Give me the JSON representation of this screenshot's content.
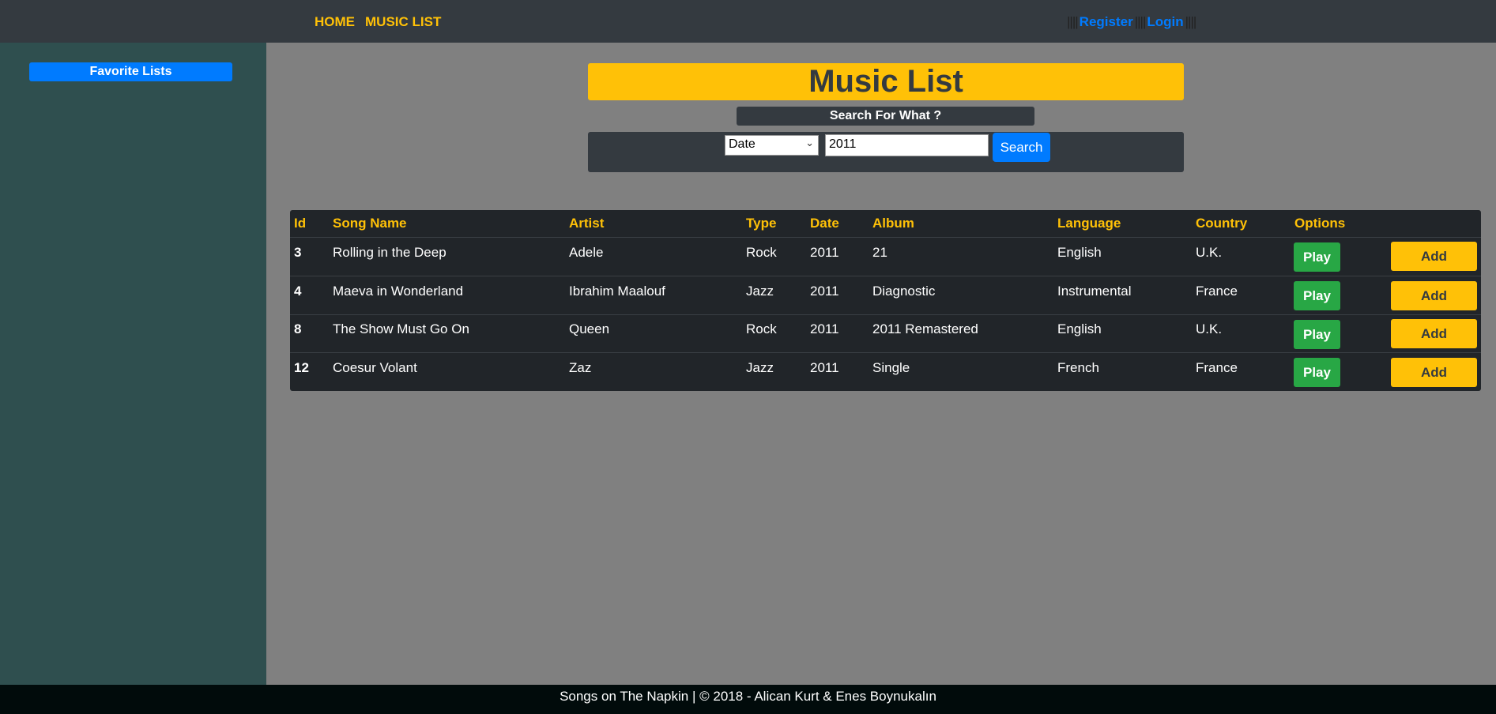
{
  "nav": {
    "home": "HOME",
    "music_list": "MUSIC LIST"
  },
  "auth": {
    "sep_left": "||||",
    "register": "Register",
    "sep_mid": "||||",
    "login": "Login",
    "sep_right": "||||"
  },
  "sidebar": {
    "favorite_lists": "Favorite Lists"
  },
  "main": {
    "title": "Music List",
    "search_label": "Search For What ?",
    "search": {
      "field": "Date",
      "query": "2011",
      "button": "Search"
    }
  },
  "table": {
    "headers": [
      "Id",
      "Song Name",
      "Artist",
      "Type",
      "Date",
      "Album",
      "Language",
      "Country",
      "Options"
    ],
    "rows": [
      {
        "id": "3",
        "song": "Rolling in the Deep",
        "artist": "Adele",
        "type": "Rock",
        "date": "2011",
        "album": "21",
        "language": "English",
        "country": "U.K.",
        "play": "Play",
        "add": "Add"
      },
      {
        "id": "4",
        "song": "Maeva in Wonderland",
        "artist": "Ibrahim Maalouf",
        "type": "Jazz",
        "date": "2011",
        "album": "Diagnostic",
        "language": "Instrumental",
        "country": "France",
        "play": "Play",
        "add": "Add"
      },
      {
        "id": "8",
        "song": "The Show Must Go On",
        "artist": "Queen",
        "type": "Rock",
        "date": "2011",
        "album": "2011 Remastered",
        "language": "English",
        "country": "U.K.",
        "play": "Play",
        "add": "Add"
      },
      {
        "id": "12",
        "song": "Coesur Volant",
        "artist": "Zaz",
        "type": "Jazz",
        "date": "2011",
        "album": "Single",
        "language": "French",
        "country": "France",
        "play": "Play",
        "add": "Add"
      }
    ]
  },
  "footer": {
    "text": "Songs on The Napkin | © 2018 - Alican Kurt & Enes Boynukalın"
  }
}
